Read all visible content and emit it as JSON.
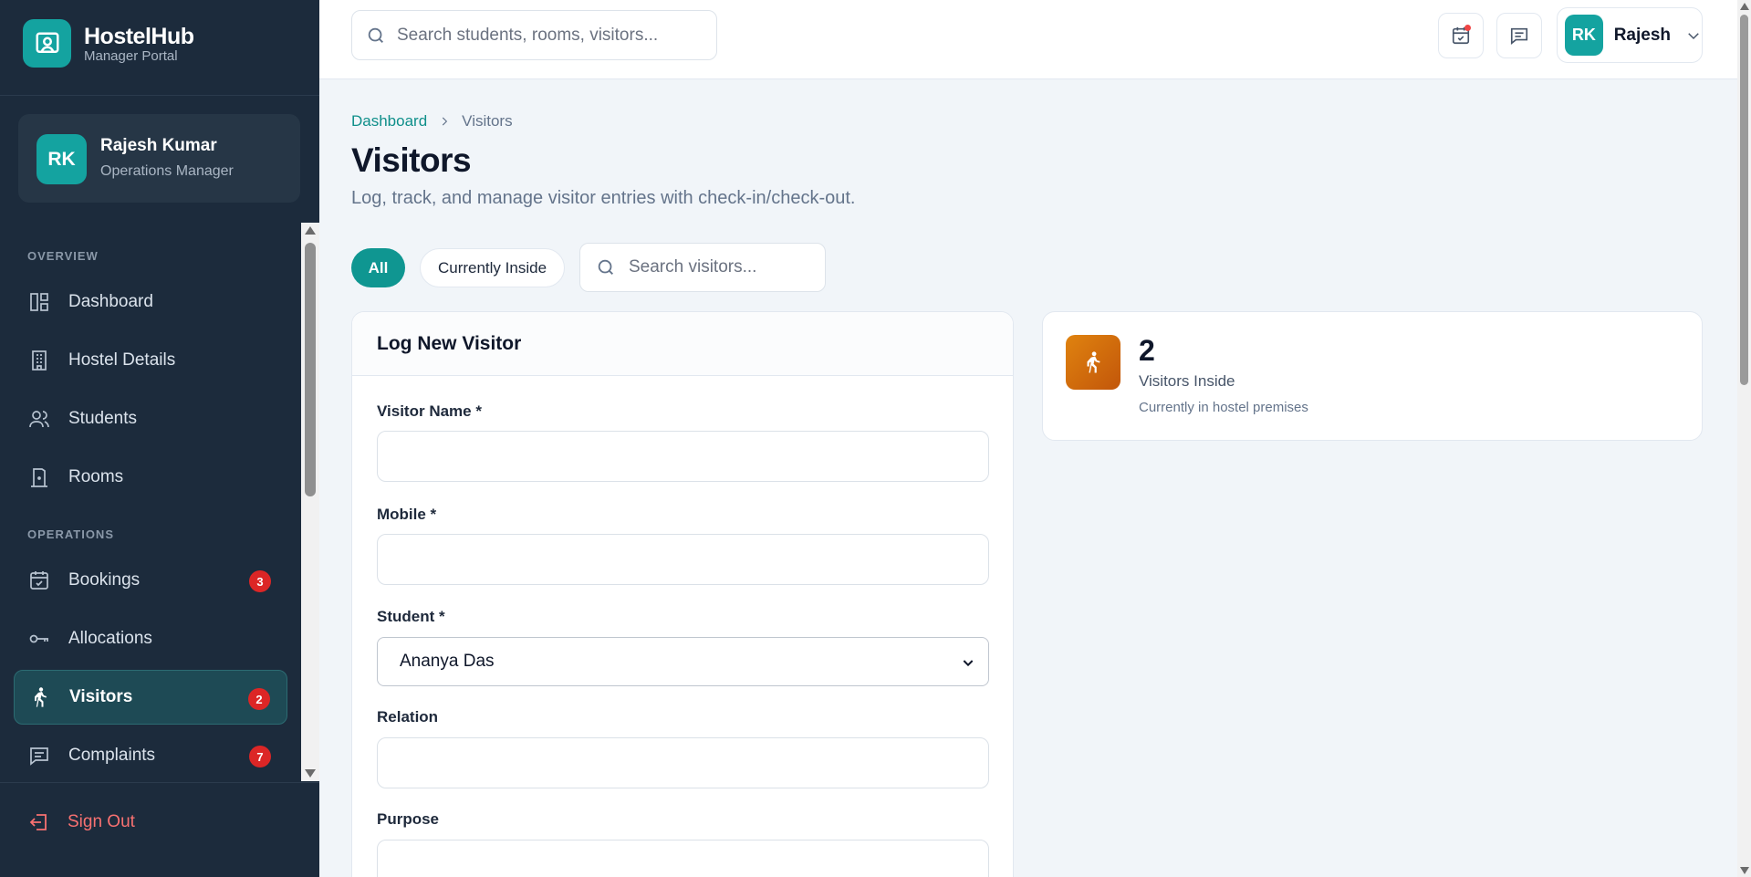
{
  "brand": {
    "name": "HostelHub",
    "subtitle": "Manager Portal"
  },
  "user": {
    "initials": "RK",
    "name": "Rajesh Kumar",
    "role": "Operations Manager"
  },
  "nav": {
    "overview_label": "OVERVIEW",
    "operations_label": "OPERATIONS",
    "items": [
      {
        "label": "Dashboard",
        "icon": "dashboard-icon"
      },
      {
        "label": "Hostel Details",
        "icon": "building-icon"
      },
      {
        "label": "Students",
        "icon": "users-icon"
      },
      {
        "label": "Rooms",
        "icon": "door-icon"
      },
      {
        "label": "Bookings",
        "icon": "calendar-check-icon",
        "badge": "3"
      },
      {
        "label": "Allocations",
        "icon": "key-icon"
      },
      {
        "label": "Visitors",
        "icon": "walking-icon",
        "badge": "2",
        "active": true
      },
      {
        "label": "Complaints",
        "icon": "message-icon",
        "badge": "7"
      }
    ],
    "sign_out": "Sign Out"
  },
  "header": {
    "search_placeholder": "Search students, rooms, visitors...",
    "profile_initials": "RK",
    "profile_name": "Rajesh"
  },
  "page": {
    "breadcrumb_home": "Dashboard",
    "breadcrumb_current": "Visitors",
    "title": "Visitors",
    "subtitle": "Log, track, and manage visitor entries with check-in/check-out."
  },
  "filters": {
    "all": "All",
    "inside": "Currently Inside",
    "search_placeholder": "Search visitors..."
  },
  "form": {
    "title": "Log New Visitor",
    "visitor_name_label": "Visitor Name *",
    "visitor_name_value": "",
    "mobile_label": "Mobile *",
    "mobile_value": "",
    "student_label": "Student *",
    "student_value": "Ananya Das",
    "relation_label": "Relation",
    "relation_value": "",
    "purpose_label": "Purpose",
    "purpose_value": ""
  },
  "stat": {
    "value": "2",
    "label": "Visitors Inside",
    "note": "Currently in hostel premises"
  },
  "colors": {
    "sidebar_bg": "#1c2b3c",
    "accent": "#14a3a0",
    "badge": "#dc2626",
    "stat_icon": "#d06a0c"
  }
}
